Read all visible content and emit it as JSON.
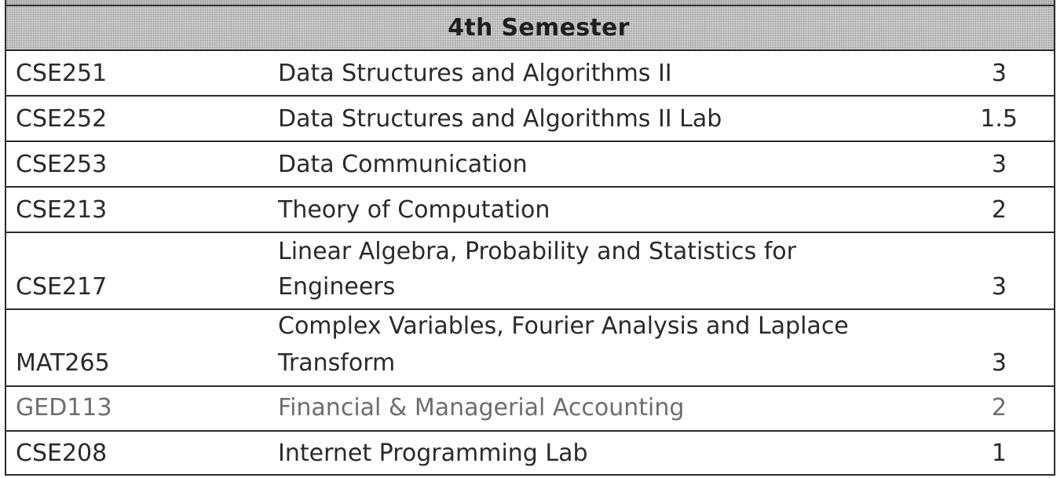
{
  "semester_title": "4th Semester",
  "courses": [
    {
      "code": "CSE251",
      "title_lines": [
        "Data Structures and Algorithms II"
      ],
      "credits": "3"
    },
    {
      "code": "CSE252",
      "title_lines": [
        "Data Structures and Algorithms II Lab"
      ],
      "credits": "1.5"
    },
    {
      "code": "CSE253",
      "title_lines": [
        "Data Communication"
      ],
      "credits": "3"
    },
    {
      "code": "CSE213",
      "title_lines": [
        "Theory of Computation"
      ],
      "credits": "2"
    },
    {
      "code": "CSE217",
      "title_lines": [
        "Linear Algebra, Probability and Statistics for",
        "Engineers"
      ],
      "credits": "3"
    },
    {
      "code": "MAT265",
      "title_lines": [
        "Complex Variables, Fourier Analysis and Laplace",
        "Transform"
      ],
      "credits": "3"
    },
    {
      "code": "GED113",
      "title_lines": [
        "Financial & Managerial Accounting"
      ],
      "credits": "2"
    },
    {
      "code": "CSE208",
      "title_lines": [
        "Internet Programming Lab"
      ],
      "credits": "1"
    }
  ]
}
